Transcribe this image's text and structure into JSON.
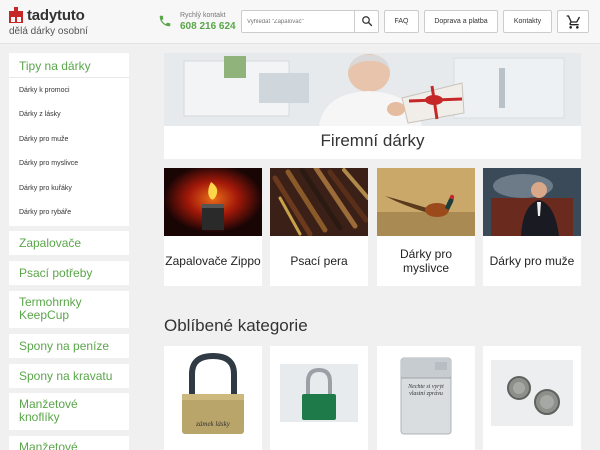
{
  "brand": {
    "name": "tadytuto",
    "tagline": "dělá dárky osobní",
    "color": "#c62828"
  },
  "contact": {
    "label": "Rychlý kontakt",
    "phone": "608 216 624",
    "icon": "phone-icon",
    "color": "#5aa64a"
  },
  "search": {
    "placeholder": "Vyhledat \"Zapalovač\"",
    "icon": "search-icon"
  },
  "nav": {
    "faq": "FAQ",
    "shipping": "Doprava a platba",
    "contacts": "Kontakty",
    "cart_icon": "cart-icon"
  },
  "sidebar": {
    "sections": [
      {
        "title": "Tipy na dárky",
        "items": [
          "Dárky k promoci",
          "Dárky z lásky",
          "Dárky pro muže",
          "Dárky pro myslivce",
          "Dárky pro kuřáky",
          "Dárky pro rybáře"
        ]
      },
      {
        "title": "Zapalovače"
      },
      {
        "title": "Psací potřeby"
      },
      {
        "title": "Termohrnky KeepCup"
      },
      {
        "title": "Spony na peníze"
      },
      {
        "title": "Spony na kravatu"
      },
      {
        "title": "Manžetové knoflíky"
      },
      {
        "title": "Manžetové"
      }
    ],
    "accent": "#5aa64a"
  },
  "hero": {
    "title": "Firemní dárky"
  },
  "categories": [
    {
      "label": "Zapalovače Zippo"
    },
    {
      "label": "Psací pera"
    },
    {
      "label": "Dárky pro myslivce"
    },
    {
      "label": "Dárky pro muže"
    }
  ],
  "favorites": {
    "title": "Oblíbené kategorie",
    "engravings": [
      "zámek lásky",
      "Nechte si vyrýt vlastní zprávu"
    ]
  }
}
